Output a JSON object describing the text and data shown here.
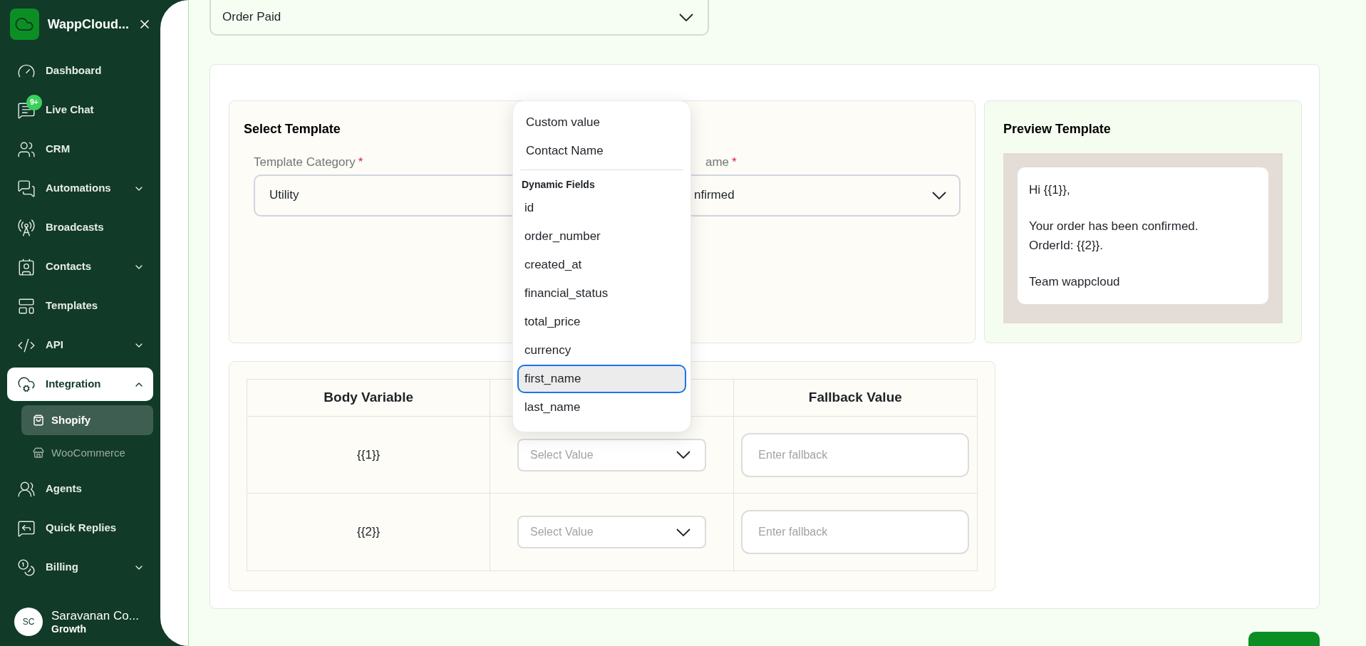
{
  "sidebar": {
    "brand": "WappCloud...",
    "items": [
      {
        "label": "Dashboard",
        "selected": false
      },
      {
        "label": "Live Chat",
        "selected": false,
        "badge": "9+"
      },
      {
        "label": "CRM",
        "selected": false
      },
      {
        "label": "Automations",
        "selected": false,
        "expanded": false
      },
      {
        "label": "Broadcasts",
        "selected": false
      },
      {
        "label": "Contacts",
        "selected": false,
        "expanded": false
      },
      {
        "label": "Templates",
        "selected": false
      },
      {
        "label": "API",
        "selected": false,
        "expanded": false
      },
      {
        "label": "Integration",
        "selected": true,
        "expanded": true,
        "children": [
          {
            "label": "Shopify",
            "selected": true
          },
          {
            "label": "WooCommerce",
            "selected": false
          }
        ]
      },
      {
        "label": "Agents",
        "selected": false
      },
      {
        "label": "Quick Replies",
        "selected": false
      },
      {
        "label": "Billing",
        "selected": false,
        "expanded": false
      }
    ],
    "profile": {
      "initials": "SC",
      "name": "Saravanan Co...",
      "plan": "Growth"
    }
  },
  "trigger_select": {
    "value": "Order Paid"
  },
  "select_template": {
    "title": "Select Template",
    "category": {
      "label": "Template Category",
      "required_mark": "*",
      "value": "Utility"
    },
    "name": {
      "label": "ame",
      "required_mark": "*",
      "value": "nfirmed"
    }
  },
  "preview": {
    "title": "Preview Template",
    "paragraphs": [
      [
        "Hi {{1}},"
      ],
      [
        "Your order has been confirmed.",
        "OrderId: {{2}}."
      ],
      [
        "Team wappcloud"
      ]
    ]
  },
  "variables_table": {
    "columns": {
      "column_1": "Body Variable",
      "column_3": "Fallback Value"
    },
    "rows": [
      {
        "variable": "{{1}}",
        "value_placeholder": "Select Value",
        "fallback_placeholder": "Enter fallback"
      },
      {
        "variable": "{{2}}",
        "value_placeholder": "Select Value",
        "fallback_placeholder": "Enter fallback"
      }
    ]
  },
  "value_menu": {
    "items": [
      {
        "label": "Custom value",
        "selected": false
      },
      {
        "label": "Contact Name",
        "selected": false
      }
    ],
    "section_title": "Dynamic Fields",
    "fields": [
      {
        "label": "id",
        "selected": false
      },
      {
        "label": "order_number",
        "selected": false
      },
      {
        "label": "created_at",
        "selected": false
      },
      {
        "label": "financial_status",
        "selected": false
      },
      {
        "label": "total_price",
        "selected": false
      },
      {
        "label": "currency",
        "selected": false
      },
      {
        "label": "first_name",
        "selected": true
      },
      {
        "label": "last_name",
        "selected": false
      }
    ]
  }
}
